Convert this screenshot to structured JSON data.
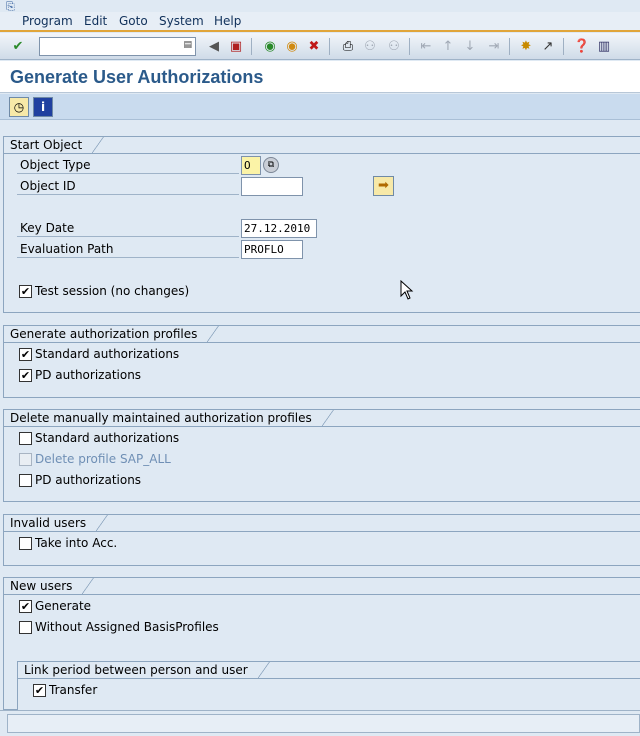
{
  "menubar": {
    "items": [
      "Program",
      "Edit",
      "Goto",
      "System",
      "Help"
    ]
  },
  "toolbar": {
    "command_value": ""
  },
  "page": {
    "title": "Generate User Authorizations"
  },
  "start_object": {
    "title": "Start Object",
    "object_type_label": "Object Type",
    "object_type_value": "O",
    "object_id_label": "Object ID",
    "object_id_value": "",
    "key_date_label": "Key Date",
    "key_date_value": "27.12.2010",
    "eval_path_label": "Evaluation Path",
    "eval_path_value": "PROFLO",
    "test_session_label": "Test session (no changes)",
    "test_session_checked": true
  },
  "generate_profiles": {
    "title": "Generate authorization profiles",
    "standard_label": "Standard authorizations",
    "pd_label": "PD authorizations"
  },
  "delete_profiles": {
    "title": "Delete manually maintained authorization profiles",
    "standard_label": "Standard authorizations",
    "sap_all_label": "Delete profile SAP_ALL",
    "pd_label": "PD authorizations"
  },
  "invalid_users": {
    "title": "Invalid users",
    "take_label": "Take into Acc."
  },
  "new_users": {
    "title": "New users",
    "generate_label": "Generate",
    "without_label": "Without Assigned BasisProfiles",
    "link_title": "Link period between person and user",
    "transfer_label": "Transfer"
  },
  "icons": {
    "check": "checkmark-icon",
    "cursor": "mouse-pointer-icon"
  }
}
